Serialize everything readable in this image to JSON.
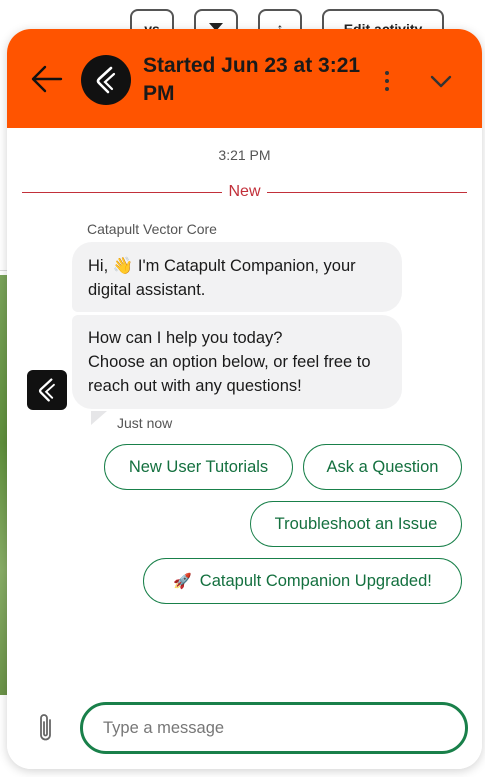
{
  "background": {
    "buttons": [
      "vs",
      "",
      "",
      "Edit activity"
    ]
  },
  "header": {
    "title": "Started Jun 23 at 3:21 PM",
    "back_icon": "arrow-left-icon",
    "more_icon": "more-vertical-icon",
    "collapse_icon": "chevron-down-icon",
    "accent_color": "#ff5400"
  },
  "conversation": {
    "timestamp": "3:21 PM",
    "new_divider_label": "New",
    "sender_name": "Catapult Vector Core",
    "messages": [
      "Hi, 👋 I'm Catapult Companion, your digital assistant.",
      "How can I help you today?\nChoose an option below, or feel free to reach out with any questions!"
    ],
    "status": "Just now"
  },
  "quick_replies": [
    "New User Tutorials",
    "Ask a Question",
    "Troubleshoot an Issue",
    "Catapult Companion Upgraded!"
  ],
  "composer": {
    "placeholder": "Type a message",
    "attach_icon": "paperclip-icon",
    "accent_color": "#19804a"
  }
}
